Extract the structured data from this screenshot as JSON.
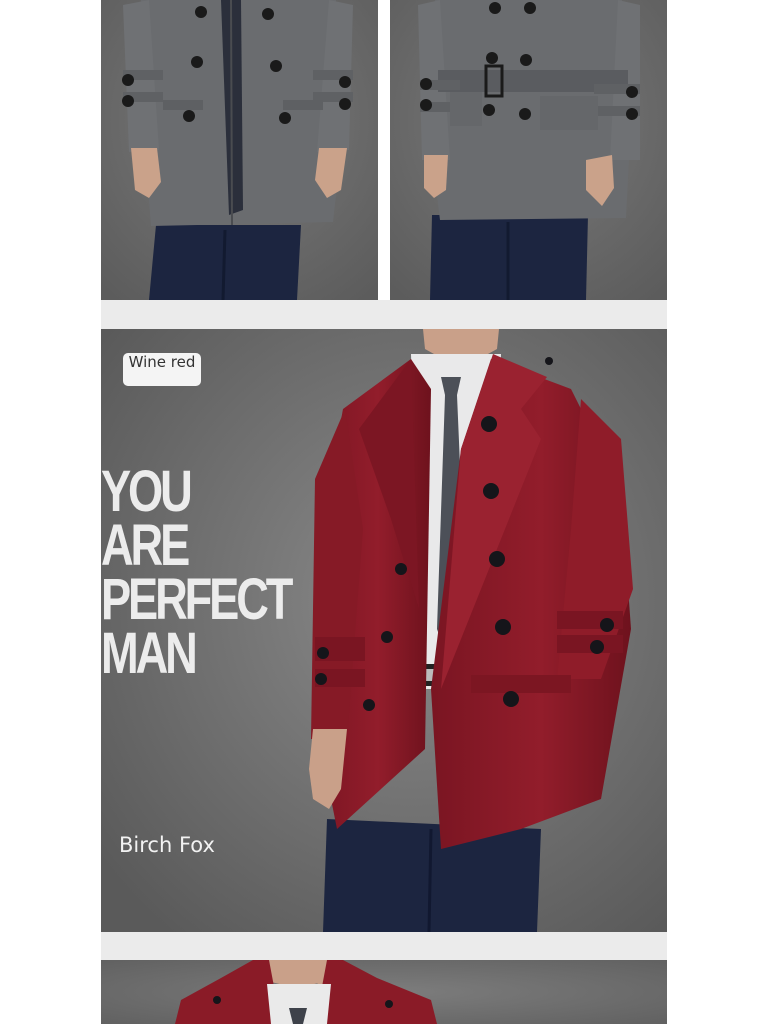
{
  "main_panel": {
    "color_label": "Wine red",
    "slogan_lines": [
      "YOU",
      "ARE",
      "PERFECT",
      "MAN"
    ],
    "brand_name": "Birch Fox"
  },
  "colors": {
    "background": "#666666",
    "grey_coat": "#6a6c6f",
    "wine_red_coat": "#8a1b27",
    "trousers": "#1c2540",
    "divider": "#ebebeb"
  }
}
